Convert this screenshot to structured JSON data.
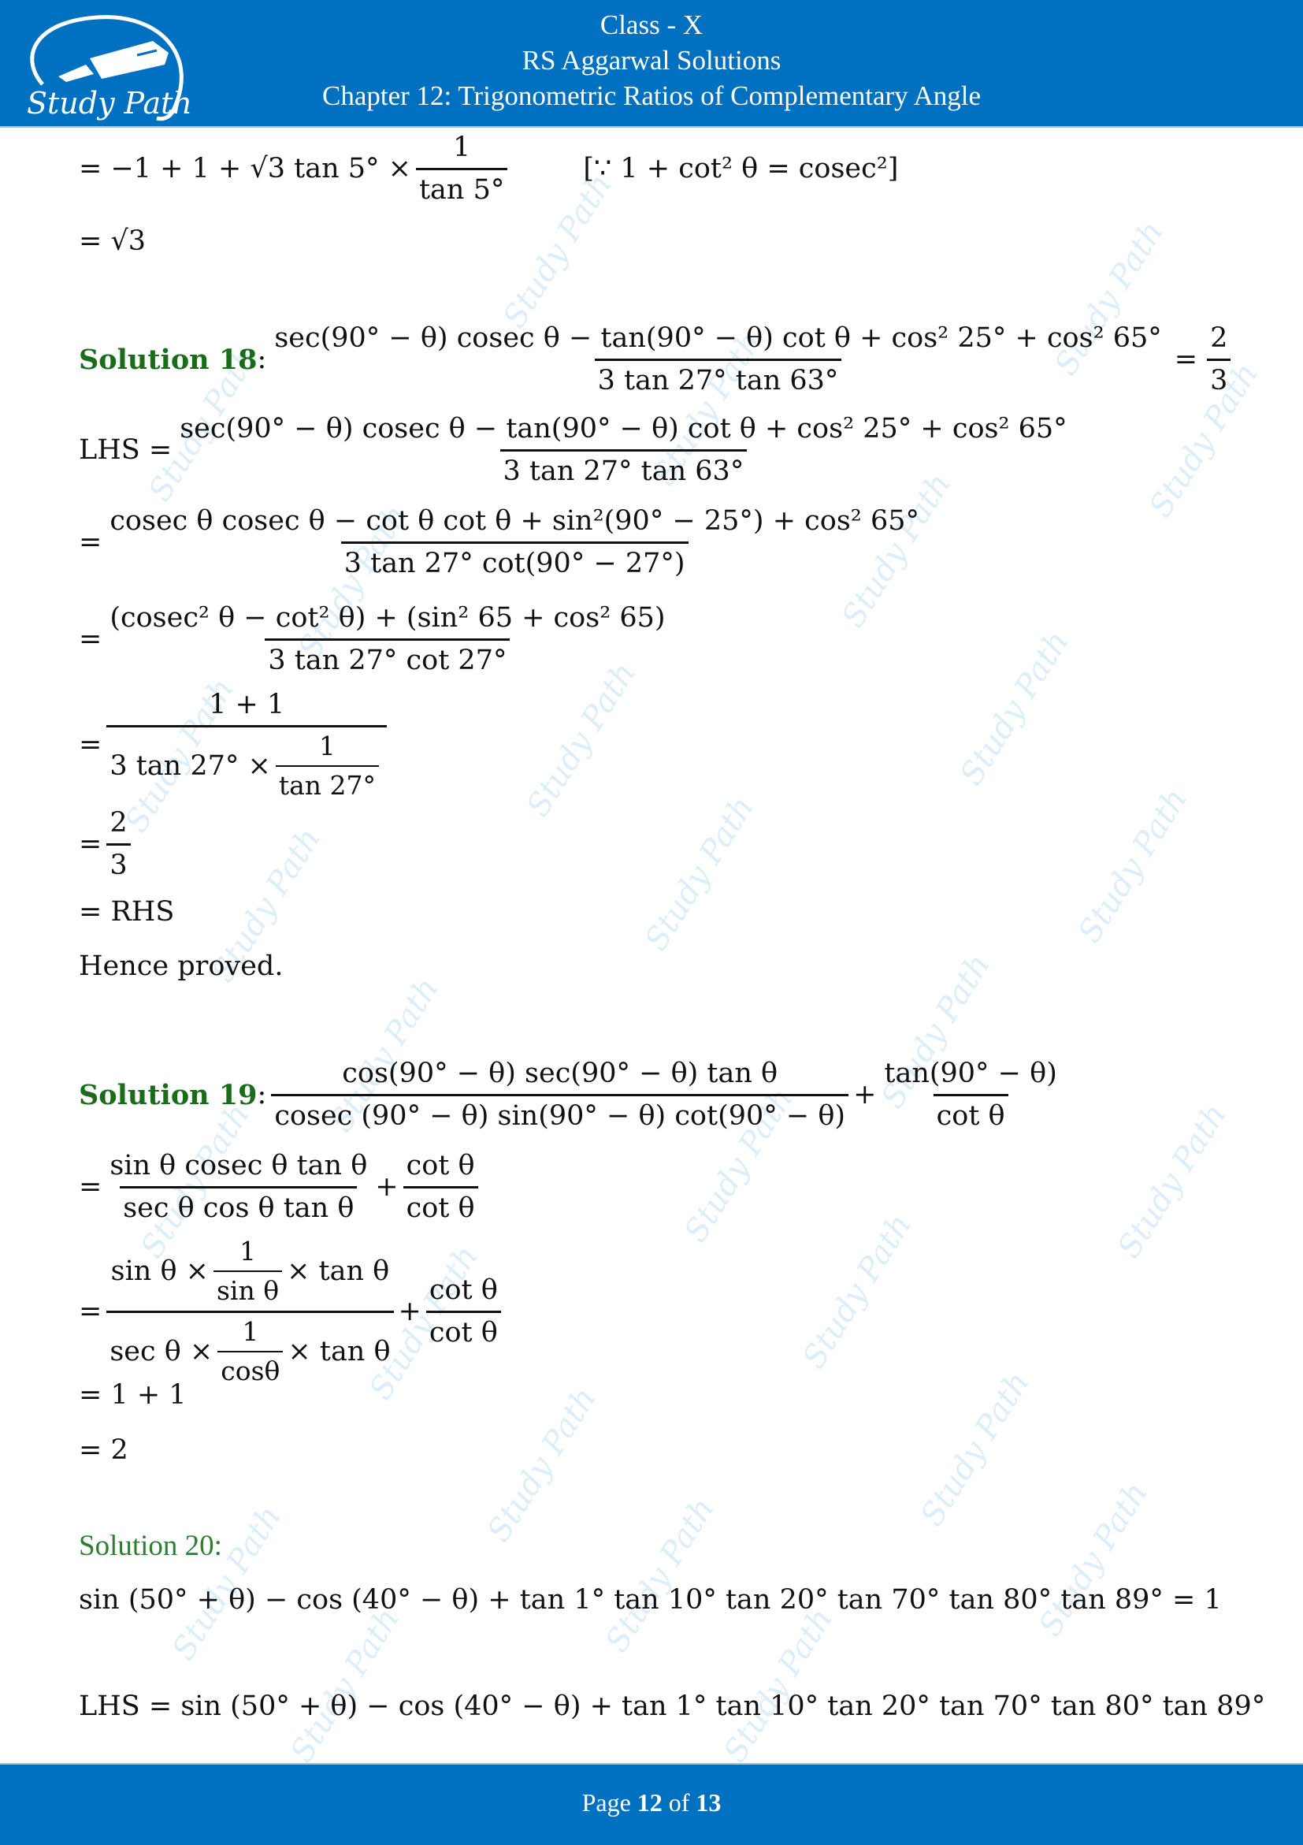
{
  "header": {
    "logo_text": "Study Path",
    "class": "Class - X",
    "book": "RS Aggarwal Solutions",
    "chapter": "Chapter 12: Trigonometric Ratios of Complementary Angle"
  },
  "watermark_text": "Study Path",
  "carry_over": {
    "line1_expr": "= −1 + 1 + √3 tan 5° ×",
    "line1_num": "1",
    "line1_den": "tan 5°",
    "line1_note": "[∵ 1 + cot² θ = cosec²]",
    "line2": "= √3"
  },
  "solution18": {
    "label": "Solution 18",
    "colon": ":",
    "question_num": "sec(90° − θ) cosec θ − tan(90° − θ) cot θ + cos² 25° + cos² 65°",
    "question_den": "3 tan 27° tan 63°",
    "question_rhs_eq": "=",
    "question_rhs_num": "2",
    "question_rhs_den": "3",
    "lhs_label": "LHS =",
    "lhs_num": "sec(90° − θ) cosec θ − tan(90° − θ) cot θ + cos² 25° + cos² 65°",
    "lhs_den": "3 tan 27° tan 63°",
    "step1_num": "cosec θ cosec θ − cot θ cot θ + sin²(90° − 25°) + cos² 65°",
    "step1_den": "3 tan 27° cot(90° − 27°)",
    "step2_num": "(cosec² θ − cot² θ) + (sin² 65 + cos² 65)",
    "step2_den": "3 tan 27° cot 27°",
    "step3_num": "1 + 1",
    "step3_den_left": "3 tan 27° ×",
    "step3_den_inner_num": "1",
    "step3_den_inner_den": "tan 27°",
    "step4_num": "2",
    "step4_den": "3",
    "step5": "= RHS",
    "conclusion": "Hence proved."
  },
  "solution19": {
    "label": "Solution 19",
    "colon": ":",
    "q_frac1_num": "cos(90° − θ) sec(90° − θ) tan θ",
    "q_frac1_den": "cosec (90° − θ) sin(90° − θ) cot(90° − θ)",
    "q_plus": "+",
    "q_frac2_num": "tan(90° − θ)",
    "q_frac2_den": "cot θ",
    "step1_frac1_num": "sin θ cosec θ tan θ",
    "step1_frac1_den": "sec θ cos θ tan θ",
    "step1_frac2_num": "cot θ",
    "step1_frac2_den": "cot θ",
    "step2_num_left": "sin θ ×",
    "step2_num_inner_num": "1",
    "step2_num_inner_den": "sin θ",
    "step2_num_right": "× tan θ",
    "step2_den_left": "sec θ ×",
    "step2_den_inner_num": "1",
    "step2_den_inner_den": "cosθ",
    "step2_den_right": "× tan θ",
    "step2_frac2_num": "cot θ",
    "step2_frac2_den": "cot θ",
    "step3": "= 1 + 1",
    "step4": "= 2"
  },
  "solution20": {
    "label": "Solution 20:",
    "question": "sin (50° + θ) − cos (40° − θ) + tan 1° tan 10° tan 20° tan 70° tan 80° tan 89° = 1",
    "lhs": "LHS = sin (50° + θ) − cos (40° − θ) + tan 1° tan 10° tan 20° tan 70° tan 80° tan 89°"
  },
  "footer": {
    "page_word": "Page",
    "page_current": "12",
    "of_word": "of",
    "page_total": "13"
  },
  "colors": {
    "brand_blue": "#0070c0",
    "solution_green": "#1a6b1a",
    "watermark": "#cfe9f7"
  }
}
